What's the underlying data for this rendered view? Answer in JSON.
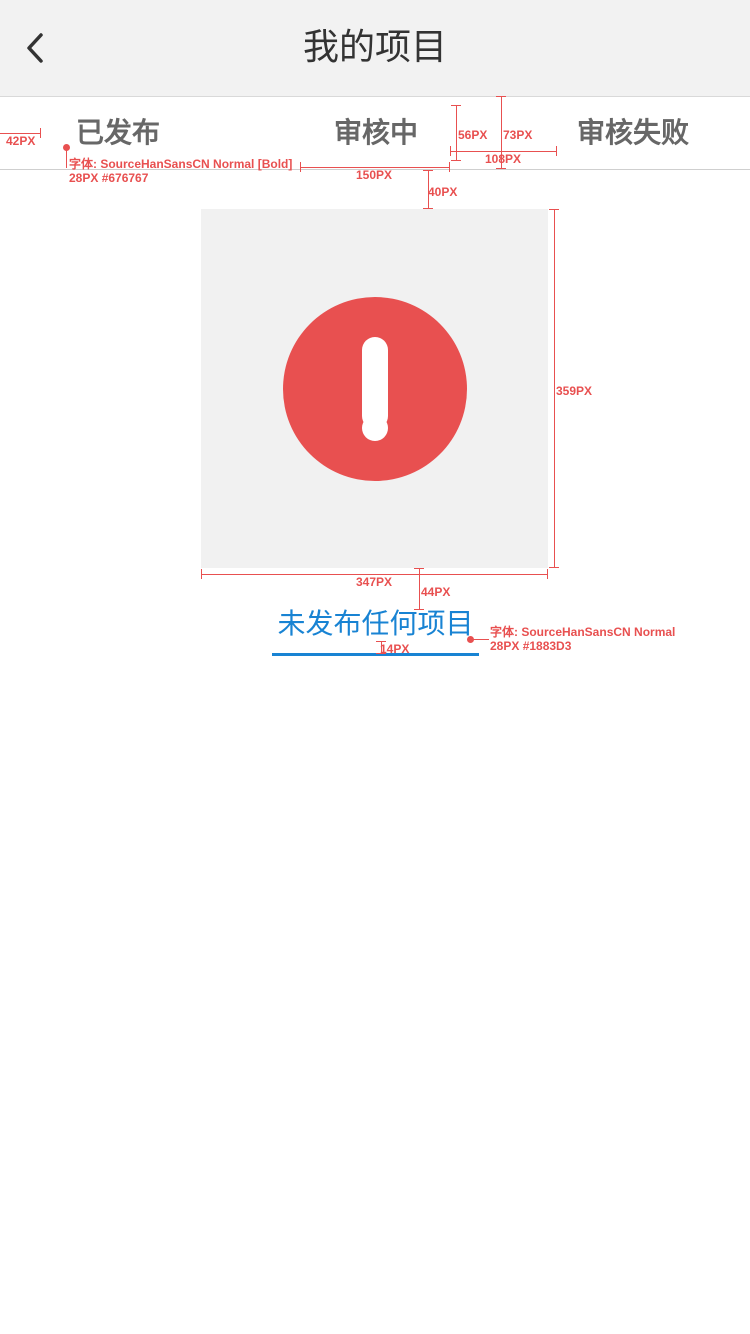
{
  "header": {
    "title": "我的项目",
    "back_icon": "chevron-left-icon"
  },
  "tabs": [
    {
      "label": "已发布"
    },
    {
      "label": "审核中"
    },
    {
      "label": "审核失败"
    }
  ],
  "empty_state": {
    "icon": "alert-circle-icon",
    "icon_color": "#e85050",
    "message": "未发布任何项目",
    "message_color": "#1883d3"
  },
  "annotations": {
    "tab_font_line1": "字体: SourceHanSansCN Normal [Bold]",
    "tab_font_line2": "28PX #676767",
    "msg_font_line1": "字体: SourceHanSansCN Normal",
    "msg_font_line2": "28PX #1883D3",
    "dim_42": "42PX",
    "dim_150": "150PX",
    "dim_56": "56PX",
    "dim_73": "73PX",
    "dim_108": "108PX",
    "dim_40": "40PX",
    "dim_359": "359PX",
    "dim_347": "347PX",
    "dim_44": "44PX",
    "dim_14": "14PX"
  },
  "colors": {
    "tab_text": "#676767",
    "accent": "#1883d3",
    "redline": "#e85050",
    "header_bg": "#f2f2f2"
  }
}
